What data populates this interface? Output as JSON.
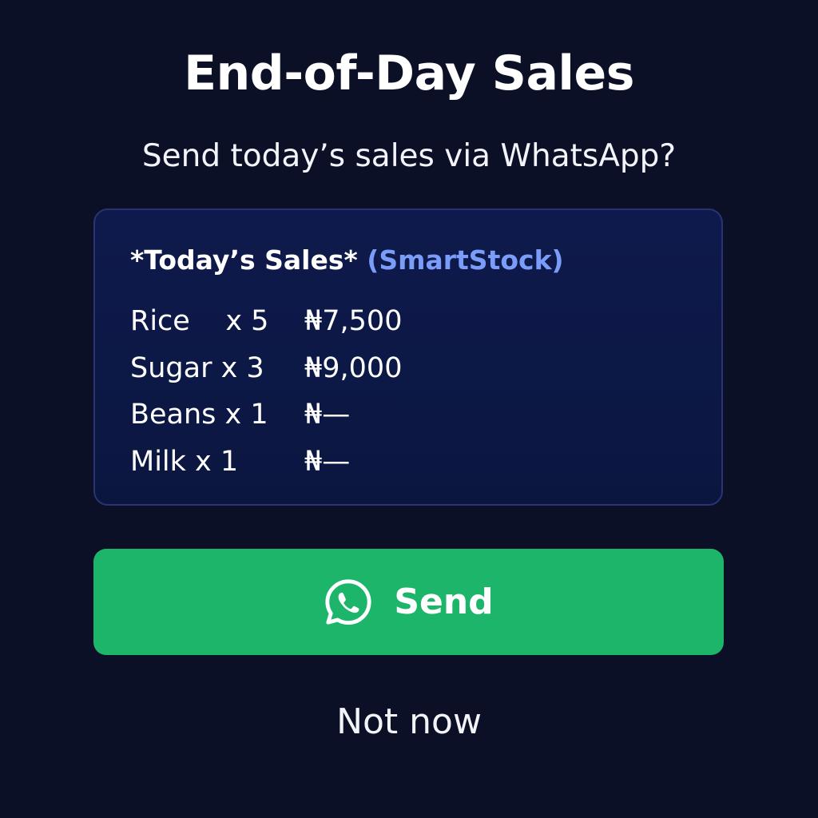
{
  "dialog": {
    "title": "End-of-Day Sales",
    "subtitle": "Send today’s sales via WhatsApp?"
  },
  "summary": {
    "header": "*Today’s Sales*",
    "brand": "(SmartStock)",
    "items": [
      {
        "item": "Rice    x 5",
        "price": "₦7,500"
      },
      {
        "item": "Sugar x 3",
        "price": "₦9,000"
      },
      {
        "item": "Beans x 1",
        "price": "₦—"
      },
      {
        "item": "Milk x 1",
        "price": "₦—"
      }
    ]
  },
  "actions": {
    "send_label": "Send",
    "send_icon": "whatsapp-icon",
    "dismiss_label": "Not now"
  },
  "colors": {
    "background": "#0b1026",
    "card_border": "#2a3475",
    "brand_accent": "#7b9dfa",
    "send_button": "#1db56a"
  }
}
